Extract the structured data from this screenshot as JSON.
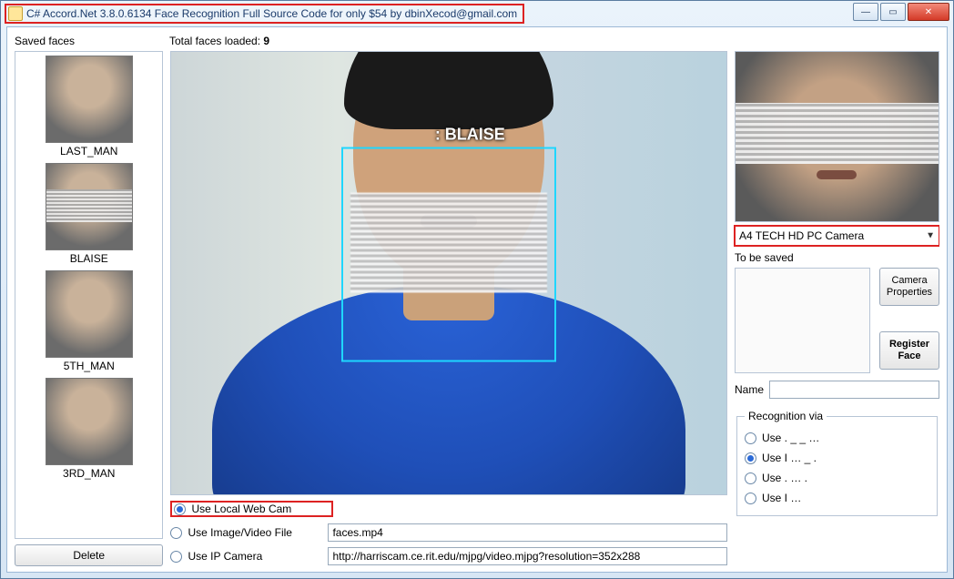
{
  "window": {
    "title": "C# Accord.Net 3.8.0.6134 Face Recognition Full Source Code for only $54 by dbinXecod@gmail.com"
  },
  "labels": {
    "saved_faces": "Saved faces",
    "total_faces_loaded": "Total faces loaded:",
    "total_faces_value": "9",
    "delete": "Delete",
    "use_local_webcam": "Use Local Web Cam",
    "use_image_video": "Use Image/Video File",
    "use_ip_camera": "Use IP Camera",
    "to_be_saved": "To be saved",
    "camera_properties": "Camera\nProperties",
    "register_face": "Register\nFace",
    "name": "Name",
    "recognition_via": "Recognition via",
    "recog_opt1": "Use .  _ _ …",
    "recog_opt2": "Use I … _ .",
    "recog_opt3": "Use . … .",
    "recog_opt4": "Use I …"
  },
  "saved_list": [
    {
      "caption": "LAST_MAN",
      "noise": false
    },
    {
      "caption": "BLAISE",
      "noise": true
    },
    {
      "caption": "5TH_MAN",
      "noise": false
    },
    {
      "caption": "3RD_MAN",
      "noise": false
    }
  ],
  "video": {
    "recognized_label": ": BLAISE"
  },
  "inputs": {
    "image_video_value": "faces.mp4",
    "ip_camera_value": "http://harriscam.ce.rit.edu/mjpg/video.mjpg?resolution=352x288",
    "camera_selected": "A4 TECH HD PC Camera",
    "name_value": ""
  },
  "selected": {
    "source": "local",
    "recognition": "opt2"
  }
}
